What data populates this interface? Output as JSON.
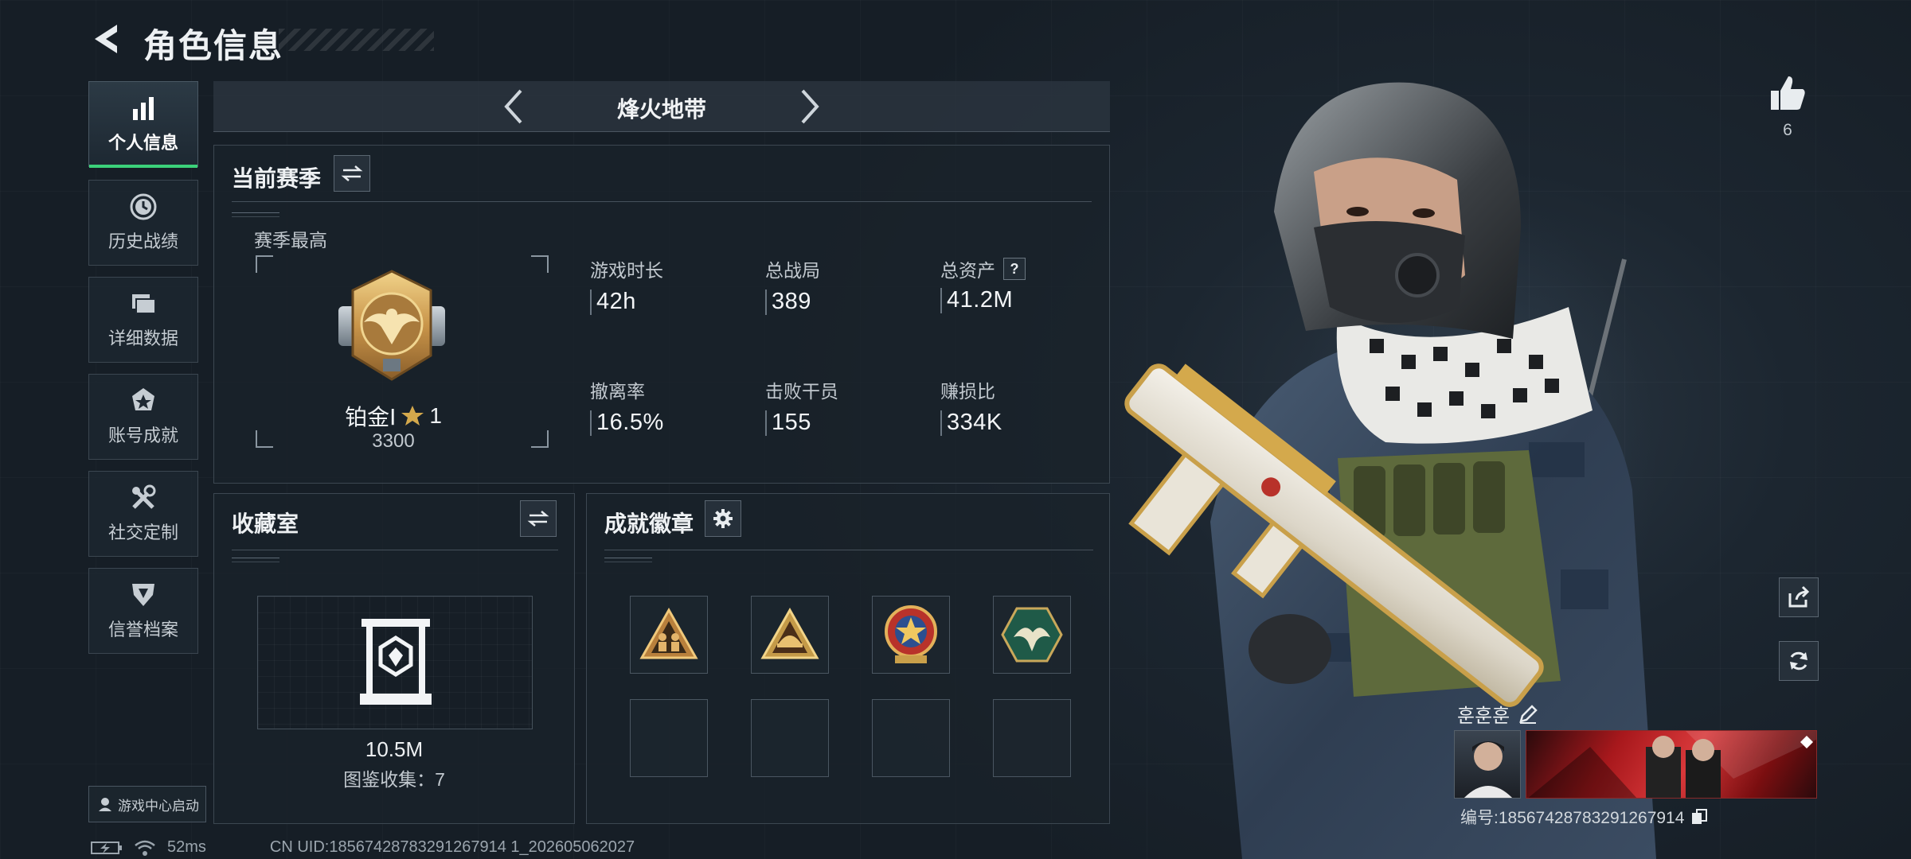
{
  "header": {
    "title": "角色信息"
  },
  "sidebar": {
    "items": [
      {
        "label": "个人信息",
        "icon": "bar-chart-icon",
        "active": true
      },
      {
        "label": "历史战绩",
        "icon": "history-clock-icon"
      },
      {
        "label": "详细数据",
        "icon": "folder-icon"
      },
      {
        "label": "账号成就",
        "icon": "achievement-icon"
      },
      {
        "label": "社交定制",
        "icon": "tools-icon"
      },
      {
        "label": "信誉档案",
        "icon": "shield-icon"
      }
    ],
    "launch_label": "游戏中心启动"
  },
  "mode": {
    "title": "烽火地带"
  },
  "season": {
    "title": "当前赛季",
    "best_label": "赛季最高",
    "rank": "铂金Ⅰ",
    "stars": "1",
    "score": "3300",
    "stats": [
      {
        "label": "游戏时长",
        "value": "42h"
      },
      {
        "label": "总战局",
        "value": "389"
      },
      {
        "label": "总资产",
        "value": "41.2M",
        "help": "?"
      },
      {
        "label": "撤离率",
        "value": "16.5%"
      },
      {
        "label": "击败干员",
        "value": "155"
      },
      {
        "label": "赚损比",
        "value": "334K"
      }
    ]
  },
  "collection": {
    "title": "收藏室",
    "value": "10.5M",
    "count_text": "图鉴收集：7"
  },
  "badges": {
    "title": "成就徽章",
    "items": [
      {
        "name": "triangle-squad-badge",
        "color": "#c8954a"
      },
      {
        "name": "triangle-helmet-badge",
        "color": "#c9a04a"
      },
      {
        "name": "star-shield-badge",
        "color": "#c0392b"
      },
      {
        "name": "hex-eagle-badge",
        "color": "#2e7d62"
      }
    ]
  },
  "right": {
    "likes": "6",
    "player_name": "훈훈훈",
    "player_id": "编号:18567428783291267914"
  },
  "status": {
    "ping": "52ms",
    "uid": "CN UID:18567428783291267914 1_202605062027"
  },
  "colors": {
    "accent": "#3bd17a",
    "gold": "#d4a94c"
  }
}
